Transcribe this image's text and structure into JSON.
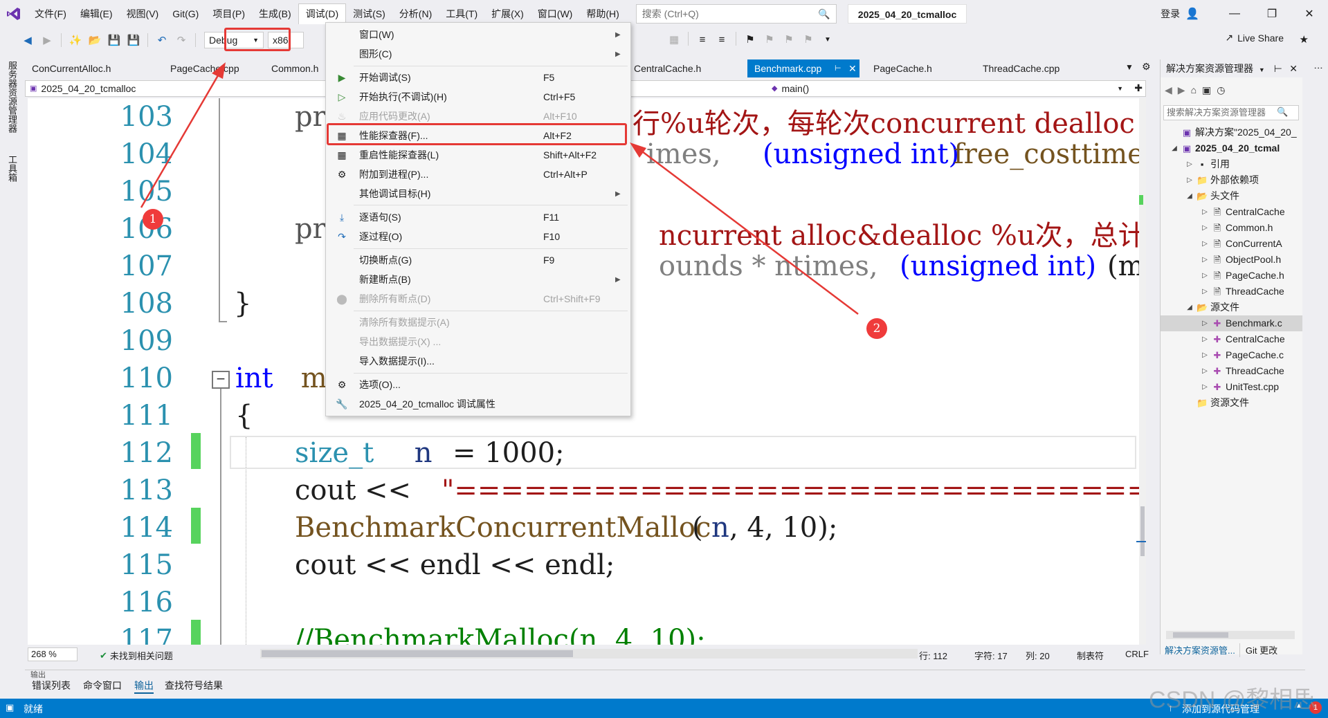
{
  "menubar": {
    "items": [
      "文件(F)",
      "编辑(E)",
      "视图(V)",
      "Git(G)",
      "项目(P)",
      "生成(B)",
      "调试(D)",
      "测试(S)",
      "分析(N)",
      "工具(T)",
      "扩展(X)",
      "窗口(W)",
      "帮助(H)"
    ],
    "search_placeholder": "搜索 (Ctrl+Q)",
    "solution_name": "2025_04_20_tcmalloc",
    "login": "登录"
  },
  "toolbar": {
    "config": "Debug",
    "platform": "x86",
    "live_share": "Live Share"
  },
  "left_strip": {
    "server_explorer": "服务器资源管理器",
    "toolbox": "工具箱"
  },
  "tabs": [
    {
      "label": "ConCurrentAlloc.h"
    },
    {
      "label": "PageCache.cpp"
    },
    {
      "label": "Common.h"
    },
    {
      "label": "CentralCache.h"
    },
    {
      "label": "Benchmark.cpp"
    },
    {
      "label": "PageCache.h"
    },
    {
      "label": "ThreadCache.cpp"
    }
  ],
  "navbar": {
    "project": "2025_04_20_tcmalloc",
    "member": "main()"
  },
  "editor": {
    "line_numbers": [
      "103",
      "104",
      "105",
      "106",
      "107",
      "108",
      "109",
      "110",
      "111",
      "112",
      "113",
      "114",
      "115",
      "116",
      "117"
    ],
    "lines": {
      "l103_a": "pr",
      "l103_b": "行%u轮次，每轮次concurrent dealloc",
      "l104_a": "imes, ",
      "l104_b": "(unsigned int)",
      "l104_c": "free_costtime)",
      "l106_a": "pr",
      "l106_b": "ncurrent alloc&dealloc %u次，总计花",
      "l107_a": "ounds * ntimes, ",
      "l107_b": "(unsigned int)",
      "l107_c": "(mal",
      "l108": "}",
      "l110_kw": "int",
      "l110_rest": " ma",
      "l111": "{",
      "l112_type": "size_t",
      "l112_var": " n ",
      "l112_rest": "= 1000;",
      "l113_a": "cout << ",
      "l113_str": "\"==================================================",
      "l114_fn": "BenchmarkConcurrentMalloc",
      "l114_a": "(",
      "l114_var": "n",
      "l114_b": ", 4, 10);",
      "l115": "cout << endl << endl;",
      "l117": "//BenchmarkMalloc(n, 4, 10);"
    }
  },
  "debug_menu": {
    "items": [
      {
        "label": "窗口(W)",
        "shortcut": "",
        "submenu": true,
        "disabled": false,
        "icon": ""
      },
      {
        "label": "图形(C)",
        "shortcut": "",
        "submenu": true,
        "disabled": false,
        "icon": ""
      },
      {
        "label": "开始调试(S)",
        "shortcut": "F5",
        "submenu": false,
        "disabled": false,
        "icon": "play-icon"
      },
      {
        "label": "开始执行(不调试)(H)",
        "shortcut": "Ctrl+F5",
        "submenu": false,
        "disabled": false,
        "icon": "play-outline-icon"
      },
      {
        "label": "应用代码更改(A)",
        "shortcut": "Alt+F10",
        "submenu": false,
        "disabled": true,
        "icon": "flame-icon"
      },
      {
        "label": "性能探查器(F)...",
        "shortcut": "Alt+F2",
        "submenu": false,
        "disabled": false,
        "icon": "profiler-icon"
      },
      {
        "label": "重启性能探查器(L)",
        "shortcut": "Shift+Alt+F2",
        "submenu": false,
        "disabled": false,
        "icon": "profiler-restart-icon"
      },
      {
        "label": "附加到进程(P)...",
        "shortcut": "Ctrl+Alt+P",
        "submenu": false,
        "disabled": false,
        "icon": "attach-icon"
      },
      {
        "label": "其他调试目标(H)",
        "shortcut": "",
        "submenu": true,
        "disabled": false,
        "icon": ""
      },
      {
        "label": "逐语句(S)",
        "shortcut": "F11",
        "submenu": false,
        "disabled": false,
        "icon": "step-into-icon"
      },
      {
        "label": "逐过程(O)",
        "shortcut": "F10",
        "submenu": false,
        "disabled": false,
        "icon": "step-over-icon"
      },
      {
        "label": "切换断点(G)",
        "shortcut": "F9",
        "submenu": false,
        "disabled": false,
        "icon": ""
      },
      {
        "label": "新建断点(B)",
        "shortcut": "",
        "submenu": true,
        "disabled": false,
        "icon": ""
      },
      {
        "label": "删除所有断点(D)",
        "shortcut": "Ctrl+Shift+F9",
        "submenu": false,
        "disabled": true,
        "icon": "delete-breakpoints-icon"
      },
      {
        "label": "清除所有数据提示(A)",
        "shortcut": "",
        "submenu": false,
        "disabled": true,
        "icon": ""
      },
      {
        "label": "导出数据提示(X) ...",
        "shortcut": "",
        "submenu": false,
        "disabled": true,
        "icon": ""
      },
      {
        "label": "导入数据提示(I)...",
        "shortcut": "",
        "submenu": false,
        "disabled": false,
        "icon": ""
      },
      {
        "label": "选项(O)...",
        "shortcut": "",
        "submenu": false,
        "disabled": false,
        "icon": "gear-icon"
      },
      {
        "label": "2025_04_20_tcmalloc 调试属性",
        "shortcut": "",
        "submenu": false,
        "disabled": false,
        "icon": "wrench-icon"
      }
    ]
  },
  "solution_explorer": {
    "title": "解决方案资源管理器",
    "search_placeholder": "搜索解决方案资源管理器",
    "items": [
      {
        "label": "解决方案\"2025_04_20_",
        "bold": false,
        "icon": "solution-icon"
      },
      {
        "label": "2025_04_20_tcmal",
        "bold": true,
        "icon": "project-icon"
      },
      {
        "label": "引用",
        "bold": false,
        "icon": "references-icon"
      },
      {
        "label": "外部依赖项",
        "bold": false,
        "icon": "folder-icon"
      },
      {
        "label": "头文件",
        "bold": false,
        "icon": "folder-icon"
      },
      {
        "label": "CentralCache",
        "bold": false,
        "icon": "header-file-icon"
      },
      {
        "label": "Common.h",
        "bold": false,
        "icon": "header-file-icon"
      },
      {
        "label": "ConCurrentA",
        "bold": false,
        "icon": "header-file-icon"
      },
      {
        "label": "ObjectPool.h",
        "bold": false,
        "icon": "header-file-icon"
      },
      {
        "label": "PageCache.h",
        "bold": false,
        "icon": "header-file-icon"
      },
      {
        "label": "ThreadCache",
        "bold": false,
        "icon": "header-file-icon"
      },
      {
        "label": "源文件",
        "bold": false,
        "icon": "folder-icon"
      },
      {
        "label": "Benchmark.c",
        "bold": false,
        "icon": "cpp-file-icon"
      },
      {
        "label": "CentralCache",
        "bold": false,
        "icon": "cpp-file-icon"
      },
      {
        "label": "PageCache.c",
        "bold": false,
        "icon": "cpp-file-icon"
      },
      {
        "label": "ThreadCache",
        "bold": false,
        "icon": "cpp-file-icon"
      },
      {
        "label": "UnitTest.cpp",
        "bold": false,
        "icon": "cpp-file-icon"
      },
      {
        "label": "资源文件",
        "bold": false,
        "icon": "folder-icon"
      }
    ],
    "bottom_tabs": [
      "解决方案资源管...",
      "Git 更改"
    ]
  },
  "editor_status": {
    "zoom": "268 %",
    "issues": "未找到相关问题",
    "line": "行: 112",
    "char": "字符: 17",
    "col": "列: 20",
    "tabs": "制表符",
    "eol": "CRLF"
  },
  "output_panel": {
    "title": "输出",
    "tabs": [
      "错误列表",
      "命令窗口",
      "输出",
      "查找符号结果"
    ]
  },
  "statusbar": {
    "ready": "就绪",
    "source_control": "添加到源代码管理",
    "notifications": "1"
  },
  "watermark": "CSDN @黎相思",
  "annotations": {
    "badge1": "1",
    "badge2": "2"
  },
  "colors": {
    "accent": "#007acc",
    "highlight": "#e53935",
    "badge": "#ef3b3b"
  }
}
